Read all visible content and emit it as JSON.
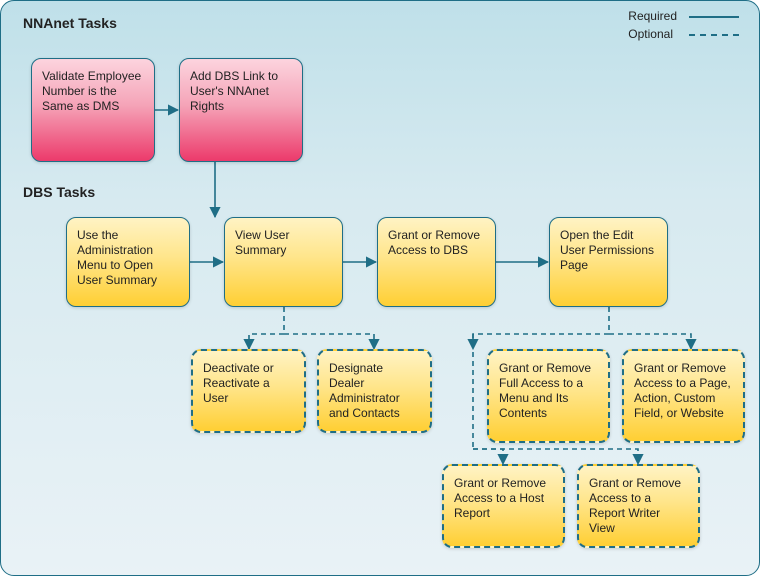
{
  "chart_data": {
    "type": "flowchart",
    "title_sections": [
      "NNAnet Tasks",
      "DBS Tasks"
    ],
    "legend": {
      "solid": "Required",
      "dashed": "Optional"
    },
    "nodes": [
      {
        "id": "n1",
        "label": "Validate Employee Number is the Same as DMS",
        "group": "NNAnet",
        "style": "required"
      },
      {
        "id": "n2",
        "label": "Add DBS Link to User's NNAnet Rights",
        "group": "NNAnet",
        "style": "required"
      },
      {
        "id": "n3",
        "label": "Use the Administration Menu to Open User Summary",
        "group": "DBS",
        "style": "required"
      },
      {
        "id": "n4",
        "label": "View User Summary",
        "group": "DBS",
        "style": "required"
      },
      {
        "id": "n5",
        "label": "Grant or Remove Access to DBS",
        "group": "DBS",
        "style": "required"
      },
      {
        "id": "n6",
        "label": "Open the Edit User Permissions Page",
        "group": "DBS",
        "style": "required"
      },
      {
        "id": "n7",
        "label": "Deactivate or Reactivate a User",
        "group": "DBS",
        "style": "optional"
      },
      {
        "id": "n8",
        "label": "Designate Dealer Administrator and Contacts",
        "group": "DBS",
        "style": "optional"
      },
      {
        "id": "n9",
        "label": "Grant or Remove Full Access to a Menu and Its Contents",
        "group": "DBS",
        "style": "optional"
      },
      {
        "id": "n10",
        "label": "Grant or Remove Access to a Page, Action, Custom Field, or Website",
        "group": "DBS",
        "style": "optional"
      },
      {
        "id": "n11",
        "label": "Grant or Remove Access to a Host Report",
        "group": "DBS",
        "style": "optional"
      },
      {
        "id": "n12",
        "label": "Grant or Remove Access to a Report Writer View",
        "group": "DBS",
        "style": "optional"
      }
    ],
    "edges": [
      {
        "from": "n1",
        "to": "n2",
        "style": "required"
      },
      {
        "from": "n2",
        "to": "n3",
        "style": "required"
      },
      {
        "from": "n3",
        "to": "n4",
        "style": "required"
      },
      {
        "from": "n4",
        "to": "n5",
        "style": "required"
      },
      {
        "from": "n5",
        "to": "n6",
        "style": "required"
      },
      {
        "from": "n4",
        "to": "n7",
        "style": "optional"
      },
      {
        "from": "n4",
        "to": "n8",
        "style": "optional"
      },
      {
        "from": "n6",
        "to": "n9",
        "style": "optional"
      },
      {
        "from": "n6",
        "to": "n10",
        "style": "optional"
      },
      {
        "from": "n6",
        "to": "n11",
        "style": "optional"
      },
      {
        "from": "n6",
        "to": "n12",
        "style": "optional"
      }
    ]
  },
  "sections": {
    "nnanet": "NNAnet Tasks",
    "dbs": "DBS Tasks"
  },
  "legend": {
    "required": "Required",
    "optional": "Optional"
  },
  "nodes": {
    "n1": "Validate Employee Number is the Same as DMS",
    "n2": "Add DBS Link to User's NNAnet Rights",
    "n3": "Use the Administration Menu to Open User Summary",
    "n4": "View User Summary",
    "n5": "Grant or Remove Access to DBS",
    "n6": "Open the Edit User Permissions Page",
    "n7": "Deactivate or Reactivate a User",
    "n8": "Designate Dealer Administrator and Contacts",
    "n9": "Grant or Remove Full Access to a Menu and Its Contents",
    "n10": "Grant or Remove Access to a Page, Action, Custom Field, or Website",
    "n11": "Grant or Remove Access to a Host Report",
    "n12": "Grant or Remove Access to a Report Writer View"
  }
}
